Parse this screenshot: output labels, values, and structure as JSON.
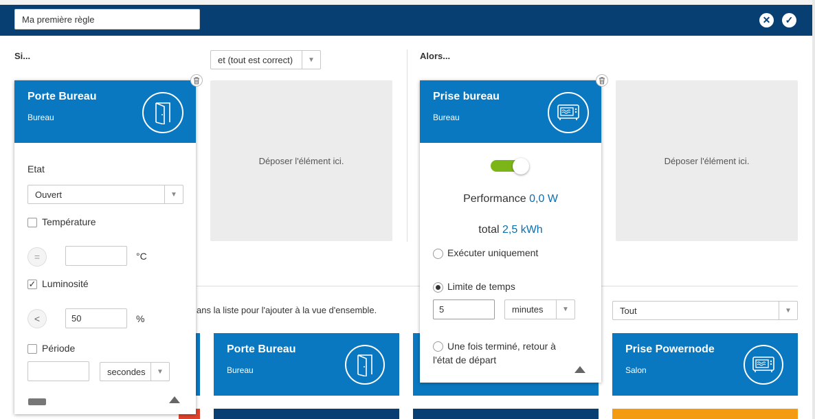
{
  "header": {
    "rule_name": "Ma première règle"
  },
  "if_section": {
    "title": "Si...",
    "logic_select": "et (tout est correct)",
    "drop_hint": "Déposer l'élément ici.",
    "device": {
      "name": "Porte Bureau",
      "room": "Bureau",
      "icon": "door-icon",
      "state_label": "Etat",
      "state_value": "Ouvert",
      "temperature": {
        "label": "Température",
        "checked": false,
        "operator": "=",
        "value": "",
        "unit": "°C"
      },
      "luminosity": {
        "label": "Luminosité",
        "checked": true,
        "operator": "<",
        "value": "50",
        "unit": "%"
      },
      "period": {
        "label": "Période",
        "checked": false,
        "value": "",
        "unit_select": "secondes"
      }
    }
  },
  "then_section": {
    "title": "Alors...",
    "drop_hint": "Déposer l'élément ici.",
    "device": {
      "name": "Prise bureau",
      "room": "Bureau",
      "icon": "microwave-icon",
      "toggle_on": true,
      "performance_label": "Performance",
      "performance_value": "0,0 W",
      "total_label": "total",
      "total_value": "2,5 kWh",
      "options": [
        {
          "label": "Exécuter uniquement",
          "selected": false
        },
        {
          "label": "Limite de temps",
          "selected": true
        },
        {
          "label": "Une fois terminé, retour à l'état de départ",
          "selected": false
        }
      ],
      "time_value": "5",
      "time_unit": "minutes"
    }
  },
  "device_list": {
    "hint": "ans la liste pour l'ajouter à la vue d'ensemble.",
    "filter": "Tout",
    "cards": [
      {
        "name": "Porte Bureau",
        "room": "Bureau",
        "icon": "door-icon"
      },
      {
        "name": "Prise Powernode",
        "room": "Salon",
        "icon": "microwave-icon"
      }
    ]
  },
  "colors": {
    "header": "#073f73",
    "card": "#0a78c0",
    "accent_green": "#7cb518",
    "orange": "#f39c12",
    "red": "#e0432c"
  }
}
